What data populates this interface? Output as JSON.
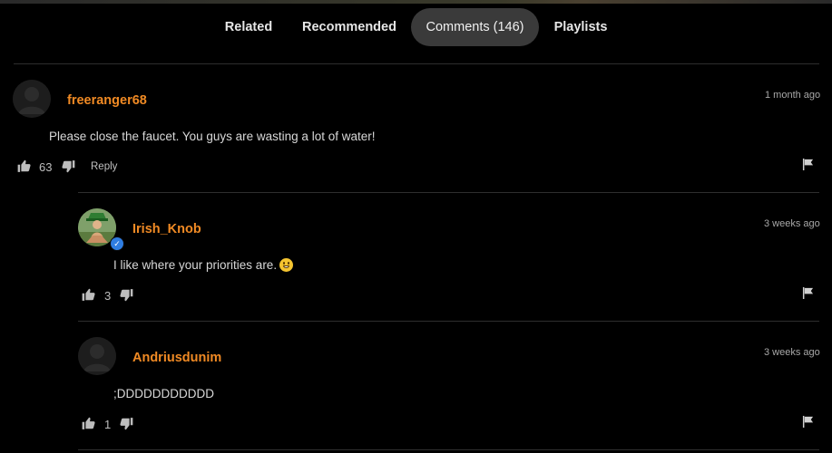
{
  "tabs": [
    {
      "label": "Related",
      "active": false
    },
    {
      "label": "Recommended",
      "active": false
    },
    {
      "label": "Comments (146)",
      "active": true
    },
    {
      "label": "Playlists",
      "active": false
    }
  ],
  "comments": [
    {
      "username": "freeranger68",
      "time": "1 month ago",
      "text": "Please close the faucet. You guys are wasting a lot of water!",
      "likes": "63",
      "reply_label": "Reply",
      "avatar": "default-avatar",
      "verified": false
    },
    {
      "username": "Irish_Knob",
      "time": "3 weeks ago",
      "text": "I like where your priorities are.",
      "emoji": "grinning-face",
      "likes": "3",
      "avatar": "leprechaun-avatar",
      "verified": true
    },
    {
      "username": "Andriusdunim",
      "time": "3 weeks ago",
      "text": ";DDDDDDDDDDD",
      "likes": "1",
      "avatar": "default-avatar",
      "verified": false
    }
  ],
  "colors": {
    "background": "#000000",
    "username": "#f08a24",
    "active_tab": "#3a3a3a",
    "verified_badge": "#2f7de1"
  }
}
